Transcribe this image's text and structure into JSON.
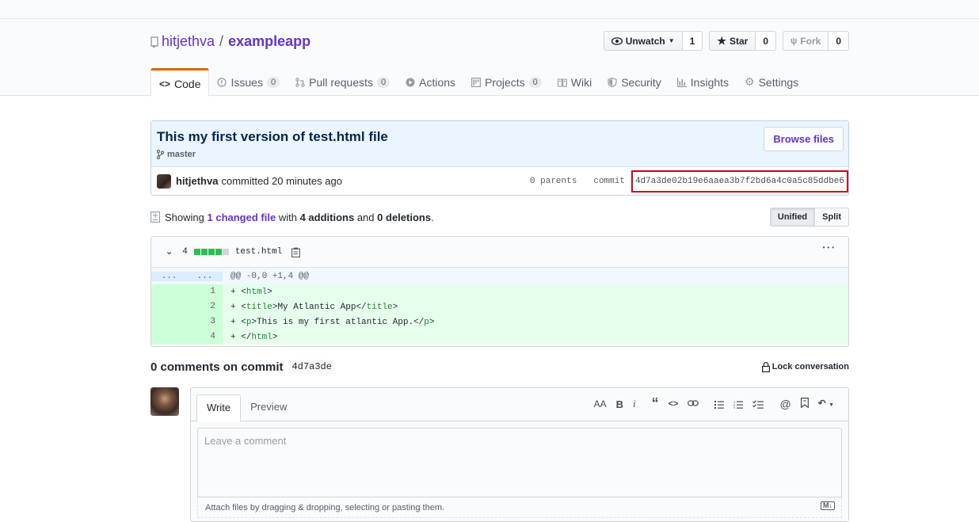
{
  "repo": {
    "owner": "hitjethva",
    "sep": "/",
    "name": "exampleapp"
  },
  "buttons": {
    "watch": {
      "label": "Unwatch",
      "count": "1"
    },
    "star": {
      "label": "Star",
      "count": "0"
    },
    "fork": {
      "label": "Fork",
      "count": "0"
    }
  },
  "tabs": [
    {
      "label": "Code"
    },
    {
      "label": "Issues",
      "count": "0"
    },
    {
      "label": "Pull requests",
      "count": "0"
    },
    {
      "label": "Actions"
    },
    {
      "label": "Projects",
      "count": "0"
    },
    {
      "label": "Wiki"
    },
    {
      "label": "Security"
    },
    {
      "label": "Insights"
    },
    {
      "label": "Settings"
    }
  ],
  "commit": {
    "title": "This my first version of test.html file",
    "branch": "master",
    "browse_label": "Browse files",
    "author": "hitjethva",
    "action": "committed 20 minutes ago",
    "parents": "0 parents",
    "commit_label": "commit",
    "sha": "4d7a3de02b19e6aaea3b7f2bd6a4c0a5c85ddbe6"
  },
  "summary": {
    "showing": "Showing",
    "changed": "1 changed file",
    "with": "with",
    "additions": "4 additions",
    "and": "and",
    "deletions": "0 deletions",
    "period": ".",
    "unified": "Unified",
    "split": "Split"
  },
  "diff": {
    "count": "4",
    "filename": "test.html",
    "more": "•••",
    "hunk_left": "...",
    "hunk_right": "...",
    "hunk": "@@ -0,0 +1,4 @@",
    "lines": [
      {
        "num": "1",
        "prefix": "+ <",
        "tag": "html",
        "suffix": ">",
        "inner": "",
        "tag2": "",
        "end": ""
      },
      {
        "num": "2",
        "prefix": "+ <",
        "tag": "title",
        "suffix": ">",
        "inner": "My Atlantic App</",
        "tag2": "title",
        "end": ">"
      },
      {
        "num": "3",
        "prefix": "+ <",
        "tag": "p",
        "suffix": ">",
        "inner": "This is my first atlantic App.</",
        "tag2": "p",
        "end": ">"
      },
      {
        "num": "4",
        "prefix": "+ </",
        "tag": "html",
        "suffix": ">",
        "inner": "",
        "tag2": "",
        "end": ""
      }
    ]
  },
  "comments": {
    "title": "0 comments on commit",
    "short_sha": "4d7a3de",
    "lock": "Lock conversation"
  },
  "editor": {
    "write": "Write",
    "preview": "Preview",
    "placeholder": "Leave a comment",
    "attach": "Attach files by dragging & dropping, selecting or pasting them.",
    "toolbar": [
      "AA",
      "B",
      "i"
    ]
  }
}
